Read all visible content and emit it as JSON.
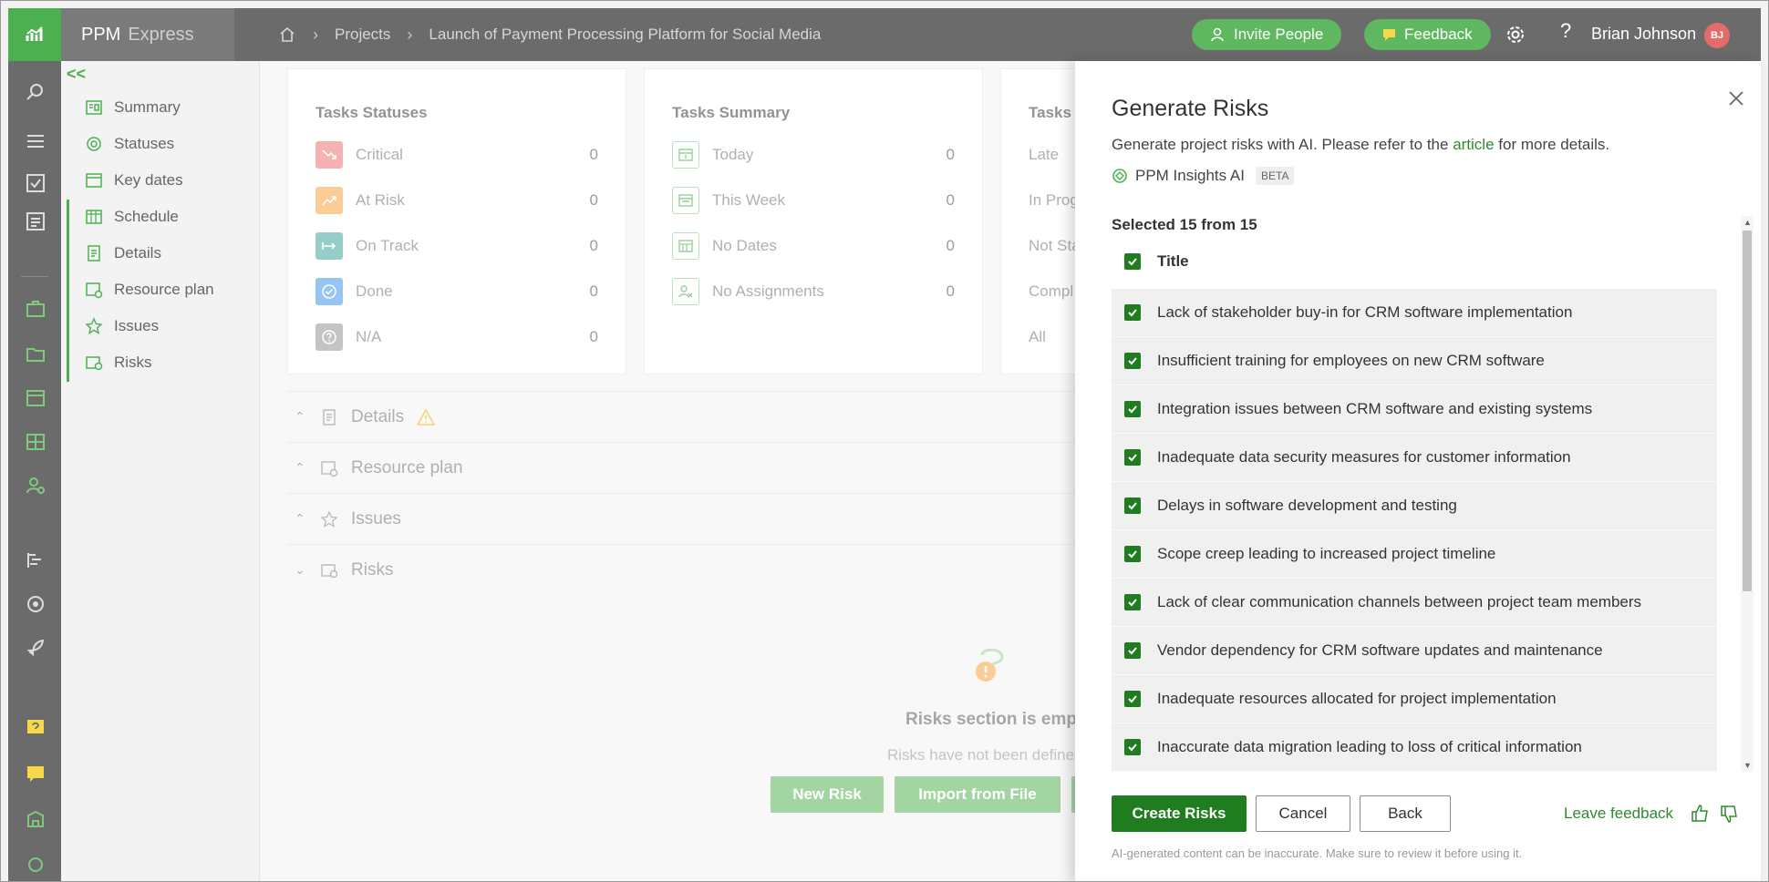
{
  "header": {
    "brand": "PPM",
    "brand_sub": "Express",
    "breadcrumb": [
      "Projects",
      "Launch of Payment Processing Platform for Social Media"
    ],
    "invite_label": "Invite People",
    "feedback_label": "Feedback",
    "help_label": "?",
    "user_name": "Brian Johnson",
    "user_initials": "BJ"
  },
  "sidebar": {
    "collapse_label": "<<",
    "items": [
      {
        "label": "Summary",
        "icon": "summary-icon"
      },
      {
        "label": "Statuses",
        "icon": "statuses-icon"
      },
      {
        "label": "Key dates",
        "icon": "calendar-icon"
      },
      {
        "label": "Schedule",
        "icon": "schedule-icon"
      },
      {
        "label": "Details",
        "icon": "details-icon"
      },
      {
        "label": "Resource plan",
        "icon": "resource-plan-icon"
      },
      {
        "label": "Issues",
        "icon": "star-icon"
      },
      {
        "label": "Risks",
        "icon": "risks-icon"
      }
    ]
  },
  "main": {
    "task_statuses": {
      "title": "Tasks Statuses",
      "rows": [
        {
          "label": "Critical",
          "value": "0",
          "color": "#f07a7a"
        },
        {
          "label": "At Risk",
          "value": "0",
          "color": "#f7a84a"
        },
        {
          "label": "On Track",
          "value": "0",
          "color": "#4aaaa0"
        },
        {
          "label": "Done",
          "value": "0",
          "color": "#4a9be8"
        },
        {
          "label": "N/A",
          "value": "0",
          "color": "#9a9a9a"
        }
      ]
    },
    "task_summary": {
      "title": "Tasks Summary",
      "rows": [
        {
          "label": "Today",
          "value": "0"
        },
        {
          "label": "This Week",
          "value": "0"
        },
        {
          "label": "No Dates",
          "value": "0"
        },
        {
          "label": "No Assignments",
          "value": "0"
        }
      ]
    },
    "task_progress": {
      "title": "Tasks P",
      "rows": [
        "Late",
        "In Prog",
        "Not Sta",
        "Compl",
        "All"
      ]
    },
    "sections": [
      {
        "label": "Details",
        "state": "expanded",
        "warning": true
      },
      {
        "label": "Resource plan",
        "state": "expanded"
      },
      {
        "label": "Issues",
        "state": "expanded"
      },
      {
        "label": "Risks",
        "state": "collapsed"
      }
    ],
    "empty_title": "Risks section is emp",
    "empty_subtitle": "Risks have not been define",
    "new_risk_label": "New Risk",
    "import_label": "Import from File"
  },
  "panel": {
    "title": "Generate Risks",
    "intro_before": "Generate project risks with AI. Please refer to the ",
    "intro_link": "article",
    "intro_after": " for more details.",
    "ai_name": "PPM Insights AI",
    "ai_badge": "BETA",
    "selected_text": "Selected 15 from 15",
    "column_title": "Title",
    "risks": [
      "Lack of stakeholder buy-in for CRM software implementation",
      "Insufficient training for employees on new CRM software",
      "Integration issues between CRM software and existing systems",
      "Inadequate data security measures for customer information",
      "Delays in software development and testing",
      "Scope creep leading to increased project timeline",
      "Lack of clear communication channels between project team members",
      "Vendor dependency for CRM software updates and maintenance",
      "Inadequate resources allocated for project implementation",
      "Inaccurate data migration leading to loss of critical information"
    ],
    "create_label": "Create Risks",
    "cancel_label": "Cancel",
    "back_label": "Back",
    "leave_feedback_label": "Leave feedback",
    "disclaimer": "AI-generated content can be inaccurate. Make sure to review it before using it."
  },
  "colors": {
    "accent": "#4caf50",
    "primary_button": "#1f7d1f",
    "topbar": "#6b6b6b"
  }
}
